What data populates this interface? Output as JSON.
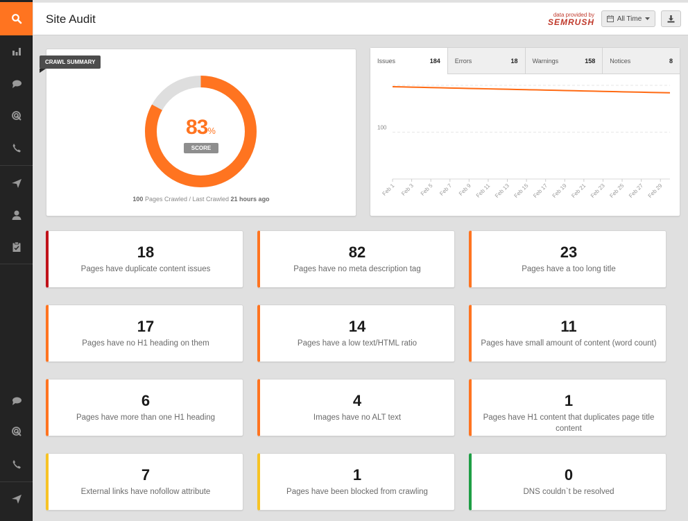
{
  "sidebar": {
    "items": [
      {
        "name": "search",
        "active": true
      },
      {
        "name": "bar-chart"
      },
      {
        "name": "chat"
      },
      {
        "name": "target"
      },
      {
        "name": "phone"
      },
      {
        "name": "send"
      },
      {
        "name": "user"
      },
      {
        "name": "clipboard-check"
      },
      {
        "name": "chat"
      },
      {
        "name": "target"
      },
      {
        "name": "phone"
      },
      {
        "name": "send"
      }
    ]
  },
  "header": {
    "title": "Site Audit",
    "provided_label": "data provided by",
    "provider": "semrush",
    "time_filter": "All Time",
    "download_icon": "download-icon"
  },
  "summary": {
    "ribbon": "CRAWL SUMMARY",
    "score": "83",
    "score_unit": "%",
    "score_fraction": 0.83,
    "score_label": "SCORE",
    "pages_crawled": "100",
    "pages_crawled_label": "Pages Crawled / Last Crawled",
    "last_crawled": "21 hours ago",
    "colors": {
      "accent": "#ff7420",
      "track": "#dedede"
    }
  },
  "tabs": [
    {
      "label": "Issues",
      "count": "184"
    },
    {
      "label": "Errors",
      "count": "18"
    },
    {
      "label": "Warnings",
      "count": "158"
    },
    {
      "label": "Notices",
      "count": "8"
    }
  ],
  "chart_data": {
    "type": "line",
    "title": "",
    "xlabel": "",
    "ylabel": "",
    "ylim": [
      0,
      200
    ],
    "y_ticks": [
      100
    ],
    "grid": true,
    "x": [
      "Feb 1",
      "Feb 2",
      "Feb 3",
      "Feb 4",
      "Feb 5",
      "Feb 6",
      "Feb 7",
      "Feb 8",
      "Feb 9",
      "Feb 10",
      "Feb 11",
      "Feb 12",
      "Feb 13",
      "Feb 14",
      "Feb 15",
      "Feb 16",
      "Feb 17",
      "Feb 18",
      "Feb 19",
      "Feb 20",
      "Feb 21",
      "Feb 22",
      "Feb 23",
      "Feb 24",
      "Feb 25",
      "Feb 26",
      "Feb 27",
      "Feb 28",
      "Feb 29",
      "Feb 30"
    ],
    "x_tick_labels": [
      "Feb 1",
      "Feb 3",
      "Feb 5",
      "Feb 7",
      "Feb 9",
      "Feb 11",
      "Feb 13",
      "Feb 15",
      "Feb 17",
      "Feb 19",
      "Feb 21",
      "Feb 23",
      "Feb 25",
      "Feb 27",
      "Feb 29"
    ],
    "series": [
      {
        "name": "Issues",
        "color": "#ff6a13",
        "values": [
          197,
          196.6,
          196.1,
          195.7,
          195.2,
          194.8,
          194.3,
          193.9,
          193.4,
          193,
          192.5,
          192.1,
          191.6,
          191.2,
          190.7,
          190.3,
          189.8,
          189.4,
          188.9,
          188.5,
          188,
          187.6,
          187.1,
          186.7,
          186.2,
          185.8,
          185.3,
          184.9,
          184.4,
          184
        ]
      }
    ]
  },
  "issues": [
    {
      "count": "18",
      "text": "Pages have duplicate content issues",
      "severity": "error",
      "color": "#c0121a"
    },
    {
      "count": "82",
      "text": "Pages have no meta description tag",
      "severity": "warning",
      "color": "#ff7420"
    },
    {
      "count": "23",
      "text": "Pages have a too long title",
      "severity": "warning",
      "color": "#ff7420"
    },
    {
      "count": "17",
      "text": "Pages have no H1 heading on them",
      "severity": "warning",
      "color": "#ff7420"
    },
    {
      "count": "14",
      "text": "Pages have a low text/HTML ratio",
      "severity": "warning",
      "color": "#ff7420"
    },
    {
      "count": "11",
      "text": "Pages have small amount of content (word count)",
      "severity": "warning",
      "color": "#ff7420"
    },
    {
      "count": "6",
      "text": "Pages have more than one H1 heading",
      "severity": "warning",
      "color": "#ff7420"
    },
    {
      "count": "4",
      "text": "Images have no ALT text",
      "severity": "warning",
      "color": "#ff7420"
    },
    {
      "count": "1",
      "text": "Pages have H1 content that duplicates page title content",
      "severity": "warning",
      "color": "#ff7420"
    },
    {
      "count": "7",
      "text": "External links have nofollow attribute",
      "severity": "notice",
      "color": "#f7c325"
    },
    {
      "count": "1",
      "text": "Pages have been blocked from crawling",
      "severity": "notice",
      "color": "#f7c325"
    },
    {
      "count": "0",
      "text": "DNS couldn`t be resolved",
      "severity": "ok",
      "color": "#1e9e45"
    }
  ]
}
